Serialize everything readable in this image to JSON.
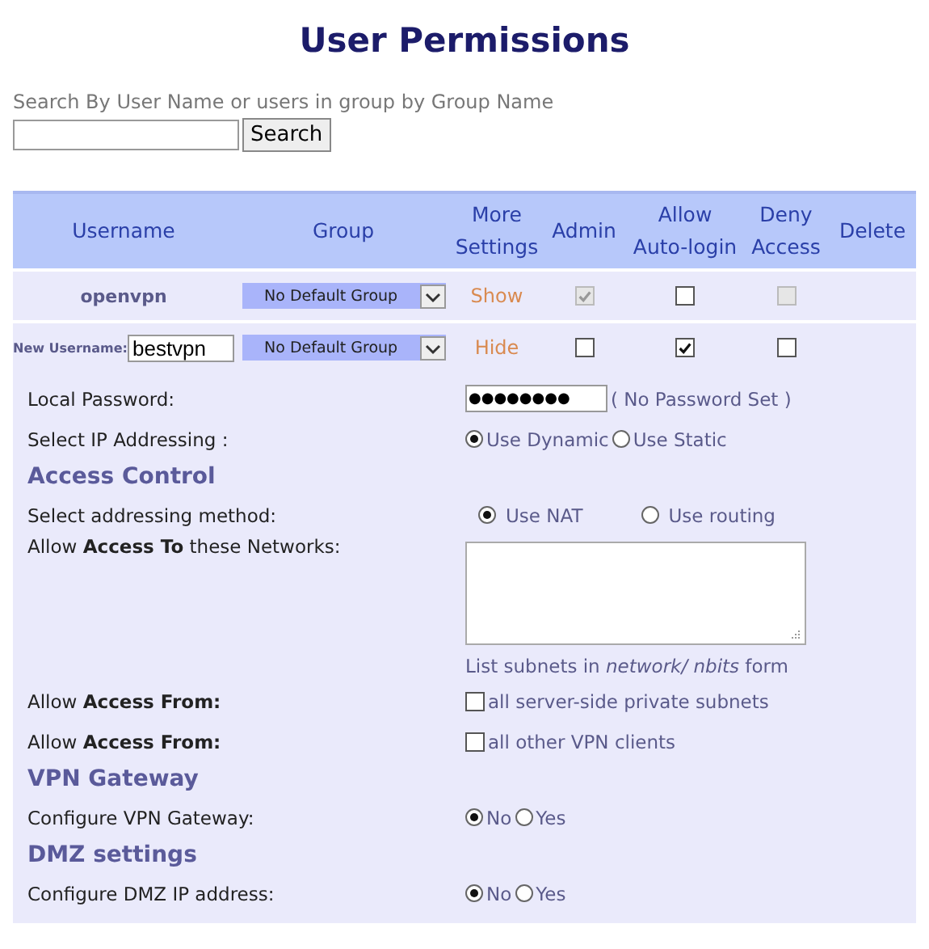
{
  "title": "User Permissions",
  "search": {
    "label": "Search By User Name or users in group by Group Name",
    "button": "Search"
  },
  "table": {
    "columns": [
      "Username",
      "Group",
      "More\nSettings",
      "Admin",
      "Allow\nAuto-login",
      "Deny\nAccess",
      "Delete"
    ],
    "rows": [
      {
        "kind": "existing",
        "username": "openvpn",
        "group": "No Default Group",
        "toggle": "Show",
        "admin": {
          "checked": true,
          "disabled": true
        },
        "autologin": {
          "checked": false,
          "disabled": false
        },
        "deny": {
          "checked": false,
          "disabled": true
        }
      },
      {
        "kind": "new",
        "label": "New Username:",
        "username": "bestvpn",
        "group": "No Default Group",
        "toggle": "Hide",
        "admin": {
          "checked": false,
          "disabled": false
        },
        "autologin": {
          "checked": true,
          "disabled": false
        },
        "deny": {
          "checked": false,
          "disabled": false
        }
      }
    ]
  },
  "settings": [
    {
      "kind": "password",
      "label": "Local Password:",
      "mask": "●●●●●●●●",
      "note": "( No Password Set )"
    },
    {
      "kind": "radio",
      "label": "Select IP Addressing :",
      "options": [
        {
          "label": "Use Dynamic",
          "selected": true
        },
        {
          "label": "Use Static",
          "selected": false
        }
      ]
    },
    {
      "kind": "heading",
      "label": "Access Control"
    },
    {
      "kind": "radio-wide",
      "label": "Select addressing method:",
      "options": [
        {
          "label": "Use NAT",
          "selected": true
        },
        {
          "label": "Use routing",
          "selected": false
        }
      ]
    },
    {
      "kind": "textarea",
      "label": "Allow **Access To** these Networks:",
      "hint": "List subnets in *network/ nbits* form"
    },
    {
      "kind": "checkbox",
      "label": "Allow **Access From:**",
      "option": "all server-side private subnets",
      "checked": false
    },
    {
      "kind": "checkbox",
      "label": "Allow **Access From:**",
      "option": "all other VPN clients",
      "checked": false
    },
    {
      "kind": "heading",
      "label": "VPN Gateway"
    },
    {
      "kind": "radio",
      "label": "Configure VPN Gateway:",
      "options": [
        {
          "label": "No",
          "selected": true
        },
        {
          "label": "Yes",
          "selected": false
        }
      ]
    },
    {
      "kind": "heading",
      "label": "DMZ settings"
    },
    {
      "kind": "radio",
      "label": "Configure DMZ IP address:",
      "options": [
        {
          "label": "No",
          "selected": true
        },
        {
          "label": "Yes",
          "selected": false
        }
      ]
    }
  ]
}
